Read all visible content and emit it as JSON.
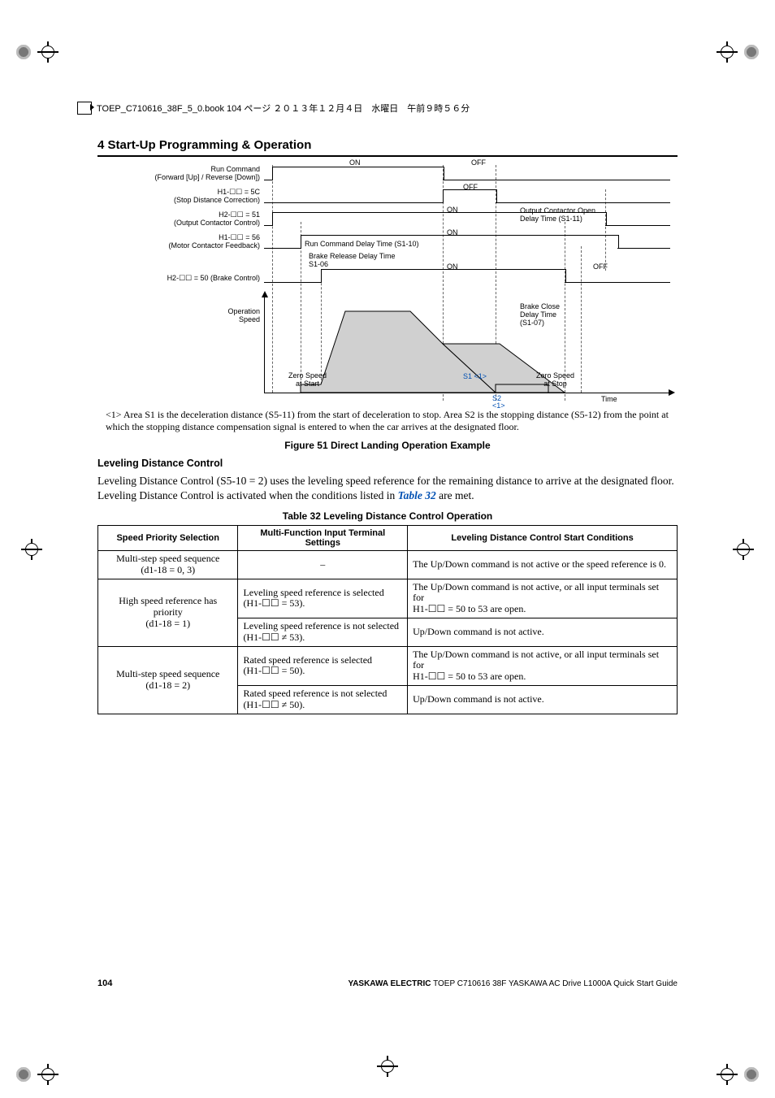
{
  "print_header": "TOEP_C710616_38F_5_0.book  104 ページ  ２０１３年１２月４日　水曜日　午前９時５６分",
  "section_title": "4  Start-Up Programming & Operation",
  "diagram": {
    "labels": {
      "run_cmd": "Run Command\n(Forward [Up] / Reverse [Down])",
      "h1_5c": "H1-☐☐ = 5C\n(Stop Distance Correction)",
      "h2_51": "H2-☐☐ = 51\n(Output Contactor Control)",
      "h1_56": "H1-☐☐ = 56\n(Motor Contactor Feedback)",
      "h2_50": "H2-☐☐ = 50 (Brake Control)",
      "op_speed": "Operation\nSpeed"
    },
    "inline": {
      "on": "ON",
      "off": "OFF",
      "run_delay": "Run Command Delay Time (S1-10)",
      "brake_release": "Brake Release Delay Time\nS1-06",
      "out_contactor": "Output Contactor Open\nDelay Time (S1-11)",
      "brake_close": "Brake Close\nDelay Time\n(S1-07)",
      "zero_start": "Zero Speed\nat Start",
      "zero_stop": "Zero Speed\nat Stop",
      "s1": "S1",
      "s1_note": "<1>",
      "s2": "S2",
      "s2_note": "<1>",
      "time": "Time"
    }
  },
  "footnote": "<1> Area S1 is the deceleration distance (S5-11) from the start of deceleration to stop. Area S2 is the stopping distance (S5-12) from the point at which the stopping distance compensation signal is entered to when the car arrives at the designated floor.",
  "fig_caption": "Figure 51  Direct Landing Operation Example",
  "subhead": "Leveling Distance Control",
  "body_text_1": "Leveling Distance Control (S5-10 = 2) uses the leveling speed reference for the remaining distance to arrive at the designated floor. Leveling Distance Control is activated when the conditions listed in ",
  "body_text_ref": "Table 32",
  "body_text_2": " are met.",
  "table_caption": "Table 32  Leveling Distance Control Operation",
  "table": {
    "headers": [
      "Speed Priority Selection",
      "Multi-Function Input Terminal Settings",
      "Leveling Distance Control Start Conditions"
    ],
    "rows": [
      {
        "c0": "Multi-step speed sequence\n(d1-18 = 0, 3)",
        "c1": "–",
        "c2": "The Up/Down command is not active or the speed reference is 0."
      },
      {
        "c0": "High speed reference has priority\n(d1-18 = 1)",
        "rowspan0": 2,
        "c1": "Leveling speed reference is selected\n(H1-☐☐ = 53).",
        "c2": "The Up/Down command is not active, or all input terminals set for\nH1-☐☐ = 50 to 53 are open."
      },
      {
        "c1": "Leveling speed reference is not selected\n(H1-☐☐ ≠ 53).",
        "c2": "Up/Down command is not active."
      },
      {
        "c0": "Multi-step speed sequence\n(d1-18 = 2)",
        "rowspan0": 2,
        "c1": "Rated speed reference is selected\n(H1-☐☐ = 50).",
        "c2": "The Up/Down command is not active, or all input terminals set for\nH1-☐☐ = 50 to 53 are open."
      },
      {
        "c1": "Rated speed reference is not selected\n(H1-☐☐   ≠ 50).",
        "c2": "Up/Down command is not active."
      }
    ]
  },
  "page_num": "104",
  "footer_company": "YASKAWA ELECTRIC",
  "footer_text": " TOEP C710616 38F YASKAWA AC Drive L1000A Quick Start Guide"
}
